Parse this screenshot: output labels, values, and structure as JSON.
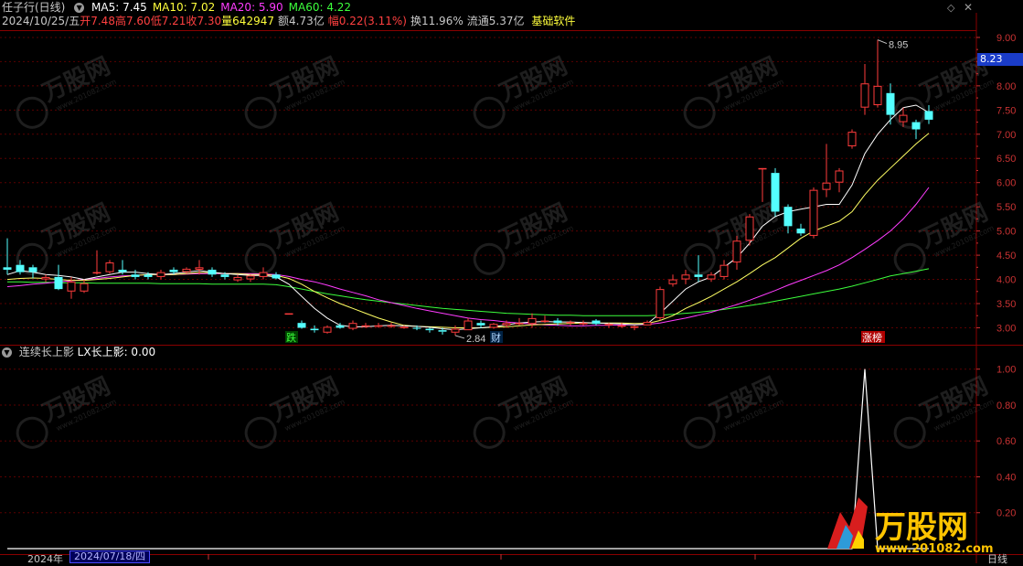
{
  "header": {
    "title": "任子行(日线)",
    "ma_labels": [
      {
        "text": "MA5: 7.45",
        "color": "#ffffff"
      },
      {
        "text": "MA10: 7.02",
        "color": "#ffff3c"
      },
      {
        "text": "MA20: 5.90",
        "color": "#ff3cff"
      },
      {
        "text": "MA60: 4.22",
        "color": "#3cff3c"
      }
    ],
    "info_date": "2024/10/25/五",
    "info_items": [
      {
        "label": "开",
        "value": "7.48",
        "color": "#ff4040"
      },
      {
        "label": "高",
        "value": "7.60",
        "color": "#ff4040"
      },
      {
        "label": "低",
        "value": "7.21",
        "color": "#ff4040"
      },
      {
        "label": "收",
        "value": "7.30",
        "color": "#ff4040"
      },
      {
        "label": "量",
        "value": "642947",
        "color": "#ffff3c"
      },
      {
        "label": "额",
        "value": "4.73亿",
        "color": "#c8c8c8"
      },
      {
        "label": "幅",
        "value": "0.22(3.11%)",
        "color": "#ff4040"
      },
      {
        "label": "换",
        "value": "11.96%",
        "color": "#c8c8c8"
      },
      {
        "label": "流通",
        "value": "5.37亿",
        "color": "#c8c8c8"
      }
    ],
    "sector": "基础软件"
  },
  "price_axis": {
    "ticks": [
      "9.00",
      "8.50",
      "8.00",
      "7.50",
      "7.00",
      "6.50",
      "6.00",
      "5.50",
      "5.00",
      "4.50",
      "4.00",
      "3.50",
      "3.00"
    ],
    "current_price": "8.23",
    "high_annotation": "8.95",
    "low_annotation": "2.84"
  },
  "event_markers": [
    {
      "text": "跌",
      "color": "#3cff3c",
      "bg": "#004400"
    },
    {
      "text": "财",
      "color": "#b4d8ff",
      "bg": "#002244"
    },
    {
      "text": "涨榜",
      "color": "#ffffff",
      "bg": "#b00000"
    }
  ],
  "indicator": {
    "name": "连续长上影",
    "series_label": "LX长上影: 0.00",
    "ticks": [
      "1.00",
      "0.80",
      "0.60",
      "0.40",
      "0.20"
    ]
  },
  "bottom_axis": {
    "date_label": "2024/07/18/四",
    "left_label": "2024年",
    "right_label": "日线"
  },
  "watermark": {
    "text": "万股网",
    "url": "www.201082.com"
  },
  "colors": {
    "up": "#ff3c3c",
    "down": "#54ffff",
    "ma5": "#ffffff",
    "ma10": "#ffff64",
    "ma20": "#ff3cff",
    "ma60": "#3cff3c",
    "grid": "#5a0000"
  },
  "chart_data": {
    "type": "candlestick",
    "ylim": [
      2.65,
      9.15
    ],
    "candles": [
      {
        "o": 4.25,
        "h": 4.85,
        "l": 4.1,
        "c": 4.2
      },
      {
        "o": 4.3,
        "h": 4.4,
        "l": 4.1,
        "c": 4.15
      },
      {
        "o": 4.25,
        "h": 4.3,
        "l": 4.02,
        "c": 4.15
      },
      {
        "o": 4.0,
        "h": 4.1,
        "l": 3.95,
        "c": 4.05
      },
      {
        "o": 4.05,
        "h": 4.3,
        "l": 3.78,
        "c": 3.8
      },
      {
        "o": 3.75,
        "h": 4.05,
        "l": 3.6,
        "c": 3.95
      },
      {
        "o": 3.75,
        "h": 4.0,
        "l": 3.72,
        "c": 3.92
      },
      {
        "o": 4.15,
        "h": 4.6,
        "l": 4.1,
        "c": 4.15
      },
      {
        "o": 4.15,
        "h": 4.4,
        "l": 4.12,
        "c": 4.35
      },
      {
        "o": 4.2,
        "h": 4.4,
        "l": 4.1,
        "c": 4.15
      },
      {
        "o": 4.1,
        "h": 4.2,
        "l": 4.0,
        "c": 4.05
      },
      {
        "o": 4.1,
        "h": 4.15,
        "l": 4.0,
        "c": 4.05
      },
      {
        "o": 4.05,
        "h": 4.2,
        "l": 4.0,
        "c": 4.15
      },
      {
        "o": 4.2,
        "h": 4.25,
        "l": 4.1,
        "c": 4.15
      },
      {
        "o": 4.15,
        "h": 4.25,
        "l": 4.12,
        "c": 4.22
      },
      {
        "o": 4.2,
        "h": 4.4,
        "l": 4.1,
        "c": 4.25
      },
      {
        "o": 4.2,
        "h": 4.25,
        "l": 4.05,
        "c": 4.1
      },
      {
        "o": 4.1,
        "h": 4.15,
        "l": 4.0,
        "c": 4.05
      },
      {
        "o": 3.98,
        "h": 4.1,
        "l": 3.95,
        "c": 4.05
      },
      {
        "o": 4.0,
        "h": 4.1,
        "l": 3.95,
        "c": 4.08
      },
      {
        "o": 4.05,
        "h": 4.25,
        "l": 4.0,
        "c": 4.15
      },
      {
        "o": 4.1,
        "h": 4.15,
        "l": 4.0,
        "c": 4.02
      },
      {
        "o": 3.3,
        "h": 3.3,
        "l": 3.3,
        "c": 3.3
      },
      {
        "o": 3.1,
        "h": 3.15,
        "l": 2.98,
        "c": 3.0
      },
      {
        "o": 2.98,
        "h": 3.05,
        "l": 2.9,
        "c": 2.95
      },
      {
        "o": 2.9,
        "h": 3.05,
        "l": 2.88,
        "c": 3.02
      },
      {
        "o": 3.05,
        "h": 3.1,
        "l": 2.98,
        "c": 3.0
      },
      {
        "o": 2.98,
        "h": 3.15,
        "l": 2.95,
        "c": 3.1
      },
      {
        "o": 3.05,
        "h": 3.1,
        "l": 3.0,
        "c": 3.05
      },
      {
        "o": 3.05,
        "h": 3.1,
        "l": 3.0,
        "c": 3.05
      },
      {
        "o": 3.05,
        "h": 3.1,
        "l": 3.0,
        "c": 3.05
      },
      {
        "o": 3.0,
        "h": 3.05,
        "l": 2.98,
        "c": 3.02
      },
      {
        "o": 3.0,
        "h": 3.05,
        "l": 2.95,
        "c": 2.98
      },
      {
        "o": 2.98,
        "h": 3.0,
        "l": 2.9,
        "c": 2.95
      },
      {
        "o": 2.95,
        "h": 3.0,
        "l": 2.86,
        "c": 2.92
      },
      {
        "o": 2.9,
        "h": 3.05,
        "l": 2.84,
        "c": 2.98
      },
      {
        "o": 2.95,
        "h": 3.2,
        "l": 2.95,
        "c": 3.15
      },
      {
        "o": 3.1,
        "h": 3.15,
        "l": 3.0,
        "c": 3.05
      },
      {
        "o": 3.0,
        "h": 3.1,
        "l": 2.98,
        "c": 3.08
      },
      {
        "o": 3.05,
        "h": 3.15,
        "l": 3.0,
        "c": 3.1
      },
      {
        "o": 3.1,
        "h": 3.2,
        "l": 3.05,
        "c": 3.1
      },
      {
        "o": 3.08,
        "h": 3.3,
        "l": 3.0,
        "c": 3.2
      },
      {
        "o": 3.15,
        "h": 3.25,
        "l": 3.1,
        "c": 3.15
      },
      {
        "o": 3.15,
        "h": 3.2,
        "l": 3.05,
        "c": 3.1
      },
      {
        "o": 3.1,
        "h": 3.15,
        "l": 3.05,
        "c": 3.12
      },
      {
        "o": 3.1,
        "h": 3.15,
        "l": 3.05,
        "c": 3.1
      },
      {
        "o": 3.15,
        "h": 3.18,
        "l": 3.05,
        "c": 3.08
      },
      {
        "o": 3.05,
        "h": 3.1,
        "l": 3.0,
        "c": 3.08
      },
      {
        "o": 3.05,
        "h": 3.1,
        "l": 3.0,
        "c": 3.05
      },
      {
        "o": 3.0,
        "h": 3.05,
        "l": 2.95,
        "c": 3.03
      },
      {
        "o": 3.05,
        "h": 3.15,
        "l": 3.05,
        "c": 3.12
      },
      {
        "o": 3.2,
        "h": 3.85,
        "l": 3.15,
        "c": 3.8
      },
      {
        "o": 3.9,
        "h": 4.1,
        "l": 3.85,
        "c": 4.0
      },
      {
        "o": 4.0,
        "h": 4.2,
        "l": 3.9,
        "c": 4.1
      },
      {
        "o": 4.1,
        "h": 4.5,
        "l": 3.95,
        "c": 4.05
      },
      {
        "o": 4.0,
        "h": 4.15,
        "l": 3.95,
        "c": 4.1
      },
      {
        "o": 4.05,
        "h": 4.4,
        "l": 4.0,
        "c": 4.3
      },
      {
        "o": 4.35,
        "h": 4.9,
        "l": 4.2,
        "c": 4.8
      },
      {
        "o": 4.8,
        "h": 5.35,
        "l": 4.7,
        "c": 5.3
      },
      {
        "o": 6.3,
        "h": 6.3,
        "l": 5.6,
        "c": 6.3
      },
      {
        "o": 6.2,
        "h": 6.3,
        "l": 5.3,
        "c": 5.4
      },
      {
        "o": 5.5,
        "h": 5.55,
        "l": 4.95,
        "c": 5.1
      },
      {
        "o": 5.05,
        "h": 5.15,
        "l": 4.9,
        "c": 4.95
      },
      {
        "o": 4.9,
        "h": 5.9,
        "l": 4.85,
        "c": 5.85
      },
      {
        "o": 5.85,
        "h": 6.8,
        "l": 5.7,
        "c": 6.0
      },
      {
        "o": 6.0,
        "h": 6.3,
        "l": 5.8,
        "c": 6.25
      },
      {
        "o": 6.75,
        "h": 7.1,
        "l": 6.7,
        "c": 7.05
      },
      {
        "o": 7.55,
        "h": 8.45,
        "l": 7.4,
        "c": 8.05
      },
      {
        "o": 7.6,
        "h": 8.95,
        "l": 7.55,
        "c": 8.0
      },
      {
        "o": 7.85,
        "h": 8.05,
        "l": 7.2,
        "c": 7.4
      },
      {
        "o": 7.25,
        "h": 7.55,
        "l": 7.15,
        "c": 7.4
      },
      {
        "o": 7.25,
        "h": 7.3,
        "l": 6.9,
        "c": 7.1
      },
      {
        "o": 7.48,
        "h": 7.6,
        "l": 7.21,
        "c": 7.3
      }
    ],
    "ma5": [
      4.1,
      4.18,
      4.15,
      4.1,
      4.08,
      4.05,
      4.0,
      4.05,
      4.1,
      4.15,
      4.15,
      4.12,
      4.1,
      4.12,
      4.15,
      4.18,
      4.15,
      4.12,
      4.1,
      4.08,
      4.08,
      4.05,
      3.9,
      3.65,
      3.4,
      3.2,
      3.05,
      3.02,
      3.02,
      3.04,
      3.05,
      3.04,
      3.03,
      3.01,
      2.98,
      2.96,
      2.98,
      3.0,
      3.02,
      3.06,
      3.1,
      3.12,
      3.13,
      3.12,
      3.12,
      3.11,
      3.1,
      3.09,
      3.08,
      3.06,
      3.08,
      3.3,
      3.55,
      3.8,
      3.95,
      4.05,
      4.25,
      4.45,
      4.75,
      5.1,
      5.3,
      5.4,
      5.45,
      5.5,
      5.55,
      5.55,
      5.95,
      6.6,
      7.0,
      7.3,
      7.55,
      7.6,
      7.45
    ],
    "ma10": [
      4.0,
      4.02,
      4.03,
      4.02,
      4.0,
      3.98,
      3.98,
      4.0,
      4.02,
      4.05,
      4.08,
      4.1,
      4.1,
      4.1,
      4.12,
      4.14,
      4.14,
      4.12,
      4.12,
      4.1,
      4.1,
      4.08,
      4.02,
      3.9,
      3.75,
      3.62,
      3.5,
      3.4,
      3.3,
      3.2,
      3.12,
      3.05,
      3.03,
      3.02,
      3.01,
      3.0,
      3.0,
      3.0,
      3.01,
      3.02,
      3.04,
      3.06,
      3.07,
      3.08,
      3.09,
      3.1,
      3.1,
      3.1,
      3.1,
      3.09,
      3.09,
      3.15,
      3.25,
      3.4,
      3.52,
      3.65,
      3.8,
      3.95,
      4.12,
      4.3,
      4.45,
      4.65,
      4.85,
      5.0,
      5.1,
      5.2,
      5.4,
      5.75,
      6.05,
      6.3,
      6.55,
      6.8,
      7.02
    ],
    "ma20": [
      3.85,
      3.87,
      3.9,
      3.92,
      3.95,
      3.97,
      4.0,
      4.02,
      4.05,
      4.07,
      4.08,
      4.1,
      4.1,
      4.1,
      4.11,
      4.12,
      4.12,
      4.12,
      4.12,
      4.12,
      4.11,
      4.1,
      4.06,
      4.0,
      3.95,
      3.88,
      3.8,
      3.73,
      3.66,
      3.58,
      3.52,
      3.46,
      3.4,
      3.35,
      3.3,
      3.25,
      3.2,
      3.17,
      3.15,
      3.12,
      3.1,
      3.08,
      3.06,
      3.05,
      3.04,
      3.04,
      3.05,
      3.05,
      3.06,
      3.06,
      3.07,
      3.1,
      3.15,
      3.2,
      3.26,
      3.32,
      3.4,
      3.48,
      3.57,
      3.67,
      3.77,
      3.88,
      3.98,
      4.08,
      4.18,
      4.3,
      4.45,
      4.62,
      4.8,
      5.0,
      5.25,
      5.55,
      5.9
    ],
    "ma60": [
      3.95,
      3.95,
      3.94,
      3.94,
      3.93,
      3.93,
      3.93,
      3.92,
      3.92,
      3.92,
      3.92,
      3.92,
      3.91,
      3.91,
      3.91,
      3.91,
      3.9,
      3.9,
      3.9,
      3.9,
      3.9,
      3.89,
      3.85,
      3.8,
      3.75,
      3.7,
      3.66,
      3.62,
      3.58,
      3.55,
      3.52,
      3.49,
      3.46,
      3.43,
      3.4,
      3.38,
      3.36,
      3.34,
      3.32,
      3.3,
      3.29,
      3.28,
      3.27,
      3.26,
      3.26,
      3.25,
      3.25,
      3.25,
      3.25,
      3.25,
      3.25,
      3.26,
      3.28,
      3.3,
      3.32,
      3.35,
      3.38,
      3.42,
      3.46,
      3.5,
      3.55,
      3.6,
      3.65,
      3.7,
      3.75,
      3.8,
      3.86,
      3.93,
      4.0,
      4.07,
      4.12,
      4.17,
      4.22
    ],
    "indicator_values": [
      0,
      0,
      0,
      0,
      0,
      0,
      0,
      0,
      0,
      0,
      0,
      0,
      0,
      0,
      0,
      0,
      0,
      0,
      0,
      0,
      0,
      0,
      0,
      0,
      0,
      0,
      0,
      0,
      0,
      0,
      0,
      0,
      0,
      0,
      0,
      0,
      0,
      0,
      0,
      0,
      0,
      0,
      0,
      0,
      0,
      0,
      0,
      0,
      0,
      0,
      0,
      0,
      0,
      0,
      0,
      0,
      0,
      0,
      0,
      0,
      0,
      0,
      0,
      0,
      0,
      0,
      0,
      1,
      0,
      0,
      0,
      0,
      0
    ],
    "indicator_ylim": [
      0,
      1.08
    ]
  }
}
